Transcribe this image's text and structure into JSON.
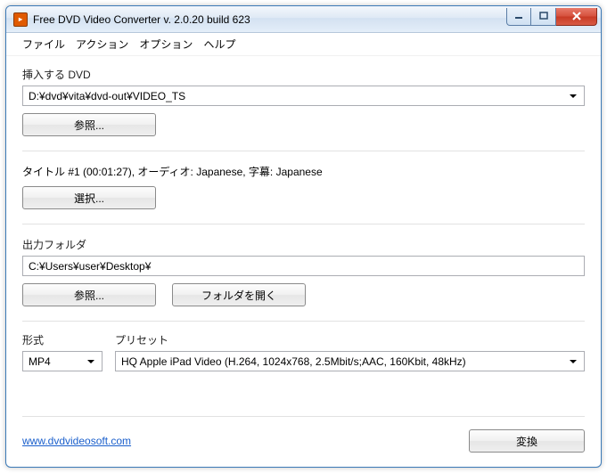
{
  "titlebar": {
    "app_name": "Free DVD Video Converter  v. 2.0.20 build 623"
  },
  "menu": {
    "file": "ファイル",
    "action": "アクション",
    "options": "オプション",
    "help": "ヘルプ"
  },
  "dvd_section": {
    "label": "挿入する DVD",
    "path": "D:¥dvd¥vita¥dvd-out¥VIDEO_TS",
    "browse": "参照..."
  },
  "title_info": "タイトル #1 (00:01:27), オーディオ: Japanese, 字幕: Japanese",
  "select_btn": "選択...",
  "output_section": {
    "label": "出力フォルダ",
    "path": "C:¥Users¥user¥Desktop¥",
    "browse": "参照...",
    "open_folder": "フォルダを開く"
  },
  "format": {
    "label": "形式",
    "value": "MP4"
  },
  "preset": {
    "label": "プリセット",
    "value": "HQ Apple iPad Video (H.264, 1024x768, 2.5Mbit/s;AAC, 160Kbit, 48kHz)"
  },
  "footer": {
    "url": "www.dvdvideosoft.com",
    "convert": "変換"
  }
}
